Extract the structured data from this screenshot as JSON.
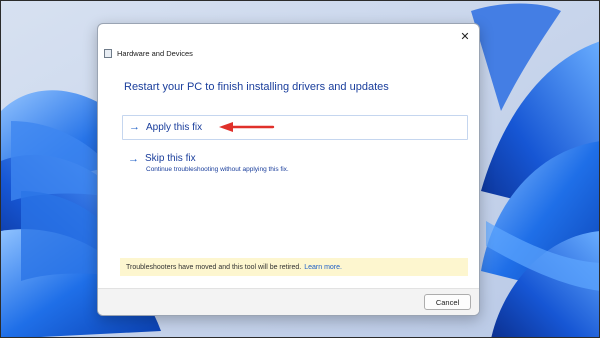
{
  "window": {
    "title": "Hardware and Devices",
    "close_glyph": "✕"
  },
  "heading": "Restart your PC to finish installing drivers and updates",
  "options": [
    {
      "label": "Apply this fix",
      "arrow": "→",
      "icon": "arrow-right-icon"
    },
    {
      "label": "Skip this fix",
      "description": "Continue troubleshooting without applying this fix.",
      "arrow": "→",
      "icon": "arrow-right-icon"
    }
  ],
  "notice": {
    "text": "Troubleshooters have moved and this tool will be retired.",
    "link": "Learn more."
  },
  "footer": {
    "cancel_label": "Cancel"
  },
  "colors": {
    "heading": "#1a3e9c",
    "link": "#1e5fc7",
    "notice_bg": "#fdf6cf",
    "callout_arrow": "#e0302a",
    "wallpaper_blue": "#1f5fd6"
  }
}
